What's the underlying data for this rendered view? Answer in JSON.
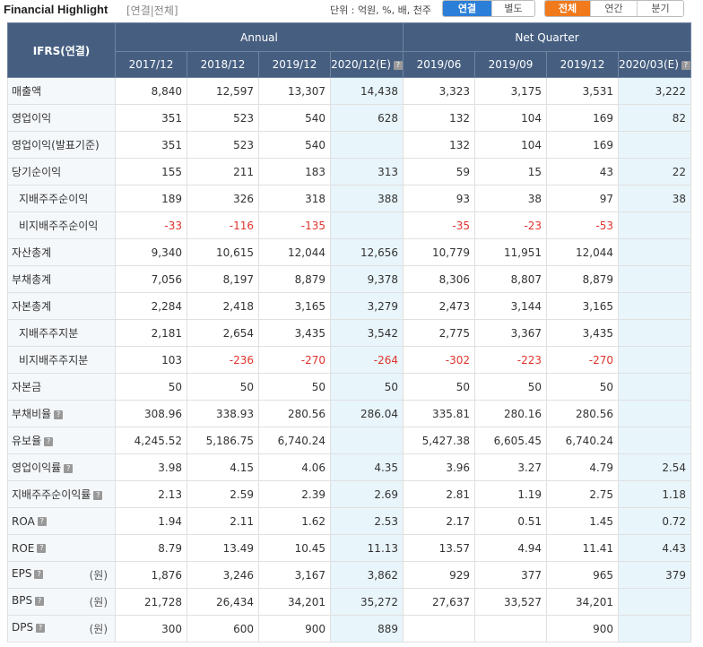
{
  "header": {
    "title": "Financial Highlight",
    "subtitle": "[연결|전체]",
    "unit": "단위 : 억원, %, 배, 천주",
    "consolidation_buttons": [
      {
        "label": "연결",
        "active": true
      },
      {
        "label": "별도",
        "active": false
      }
    ],
    "period_buttons": [
      {
        "label": "전체",
        "active": true
      },
      {
        "label": "연간",
        "active": false
      },
      {
        "label": "분기",
        "active": false
      }
    ]
  },
  "table": {
    "corner_label": "IFRS(연결)",
    "group_annual": "Annual",
    "group_quarter": "Net Quarter",
    "columns": [
      "2017/12",
      "2018/12",
      "2019/12",
      "2020/12(E)",
      "2019/06",
      "2019/09",
      "2019/12",
      "2020/03(E)"
    ],
    "estimate_columns": [
      3,
      7
    ],
    "unit_won": "(원)",
    "rows": [
      {
        "label": "매출액",
        "sub": false,
        "help": false,
        "values": [
          "8,840",
          "12,597",
          "13,307",
          "14,438",
          "3,323",
          "3,175",
          "3,531",
          "3,222"
        ]
      },
      {
        "label": "영업이익",
        "sub": false,
        "help": false,
        "values": [
          "351",
          "523",
          "540",
          "628",
          "132",
          "104",
          "169",
          "82"
        ]
      },
      {
        "label": "영업이익(발표기준)",
        "sub": false,
        "help": false,
        "values": [
          "351",
          "523",
          "540",
          "",
          "132",
          "104",
          "169",
          ""
        ]
      },
      {
        "label": "당기순이익",
        "sub": false,
        "help": false,
        "values": [
          "155",
          "211",
          "183",
          "313",
          "59",
          "15",
          "43",
          "22"
        ]
      },
      {
        "label": "지배주주순이익",
        "sub": true,
        "help": false,
        "values": [
          "189",
          "326",
          "318",
          "388",
          "93",
          "38",
          "97",
          "38"
        ]
      },
      {
        "label": "비지배주주순이익",
        "sub": true,
        "help": false,
        "values": [
          "-33",
          "-116",
          "-135",
          "",
          "-35",
          "-23",
          "-53",
          ""
        ]
      },
      {
        "label": "자산총계",
        "sub": false,
        "help": false,
        "values": [
          "9,340",
          "10,615",
          "12,044",
          "12,656",
          "10,779",
          "11,951",
          "12,044",
          ""
        ]
      },
      {
        "label": "부채총계",
        "sub": false,
        "help": false,
        "values": [
          "7,056",
          "8,197",
          "8,879",
          "9,378",
          "8,306",
          "8,807",
          "8,879",
          ""
        ]
      },
      {
        "label": "자본총계",
        "sub": false,
        "help": false,
        "values": [
          "2,284",
          "2,418",
          "3,165",
          "3,279",
          "2,473",
          "3,144",
          "3,165",
          ""
        ]
      },
      {
        "label": "지배주주지분",
        "sub": true,
        "help": false,
        "values": [
          "2,181",
          "2,654",
          "3,435",
          "3,542",
          "2,775",
          "3,367",
          "3,435",
          ""
        ]
      },
      {
        "label": "비지배주주지분",
        "sub": true,
        "help": false,
        "values": [
          "103",
          "-236",
          "-270",
          "-264",
          "-302",
          "-223",
          "-270",
          ""
        ]
      },
      {
        "label": "자본금",
        "sub": false,
        "help": false,
        "values": [
          "50",
          "50",
          "50",
          "50",
          "50",
          "50",
          "50",
          ""
        ]
      },
      {
        "label": "부채비율",
        "sub": false,
        "help": true,
        "values": [
          "308.96",
          "338.93",
          "280.56",
          "286.04",
          "335.81",
          "280.16",
          "280.56",
          ""
        ]
      },
      {
        "label": "유보율",
        "sub": false,
        "help": true,
        "values": [
          "4,245.52",
          "5,186.75",
          "6,740.24",
          "",
          "5,427.38",
          "6,605.45",
          "6,740.24",
          ""
        ]
      },
      {
        "label": "영업이익률",
        "sub": false,
        "help": true,
        "values": [
          "3.98",
          "4.15",
          "4.06",
          "4.35",
          "3.96",
          "3.27",
          "4.79",
          "2.54"
        ]
      },
      {
        "label": "지배주주순이익률",
        "sub": false,
        "help": true,
        "values": [
          "2.13",
          "2.59",
          "2.39",
          "2.69",
          "2.81",
          "1.19",
          "2.75",
          "1.18"
        ]
      },
      {
        "label": "ROA",
        "sub": false,
        "help": true,
        "values": [
          "1.94",
          "2.11",
          "1.62",
          "2.53",
          "2.17",
          "0.51",
          "1.45",
          "0.72"
        ]
      },
      {
        "label": "ROE",
        "sub": false,
        "help": true,
        "values": [
          "8.79",
          "13.49",
          "10.45",
          "11.13",
          "13.57",
          "4.94",
          "11.41",
          "4.43"
        ]
      },
      {
        "label": "EPS",
        "sub": false,
        "help": true,
        "won": true,
        "values": [
          "1,876",
          "3,246",
          "3,167",
          "3,862",
          "929",
          "377",
          "965",
          "379"
        ]
      },
      {
        "label": "BPS",
        "sub": false,
        "help": true,
        "won": true,
        "values": [
          "21,728",
          "26,434",
          "34,201",
          "35,272",
          "27,637",
          "33,527",
          "34,201",
          ""
        ]
      },
      {
        "label": "DPS",
        "sub": false,
        "help": true,
        "won": true,
        "values": [
          "300",
          "600",
          "900",
          "889",
          "",
          "",
          "900",
          ""
        ]
      }
    ]
  }
}
